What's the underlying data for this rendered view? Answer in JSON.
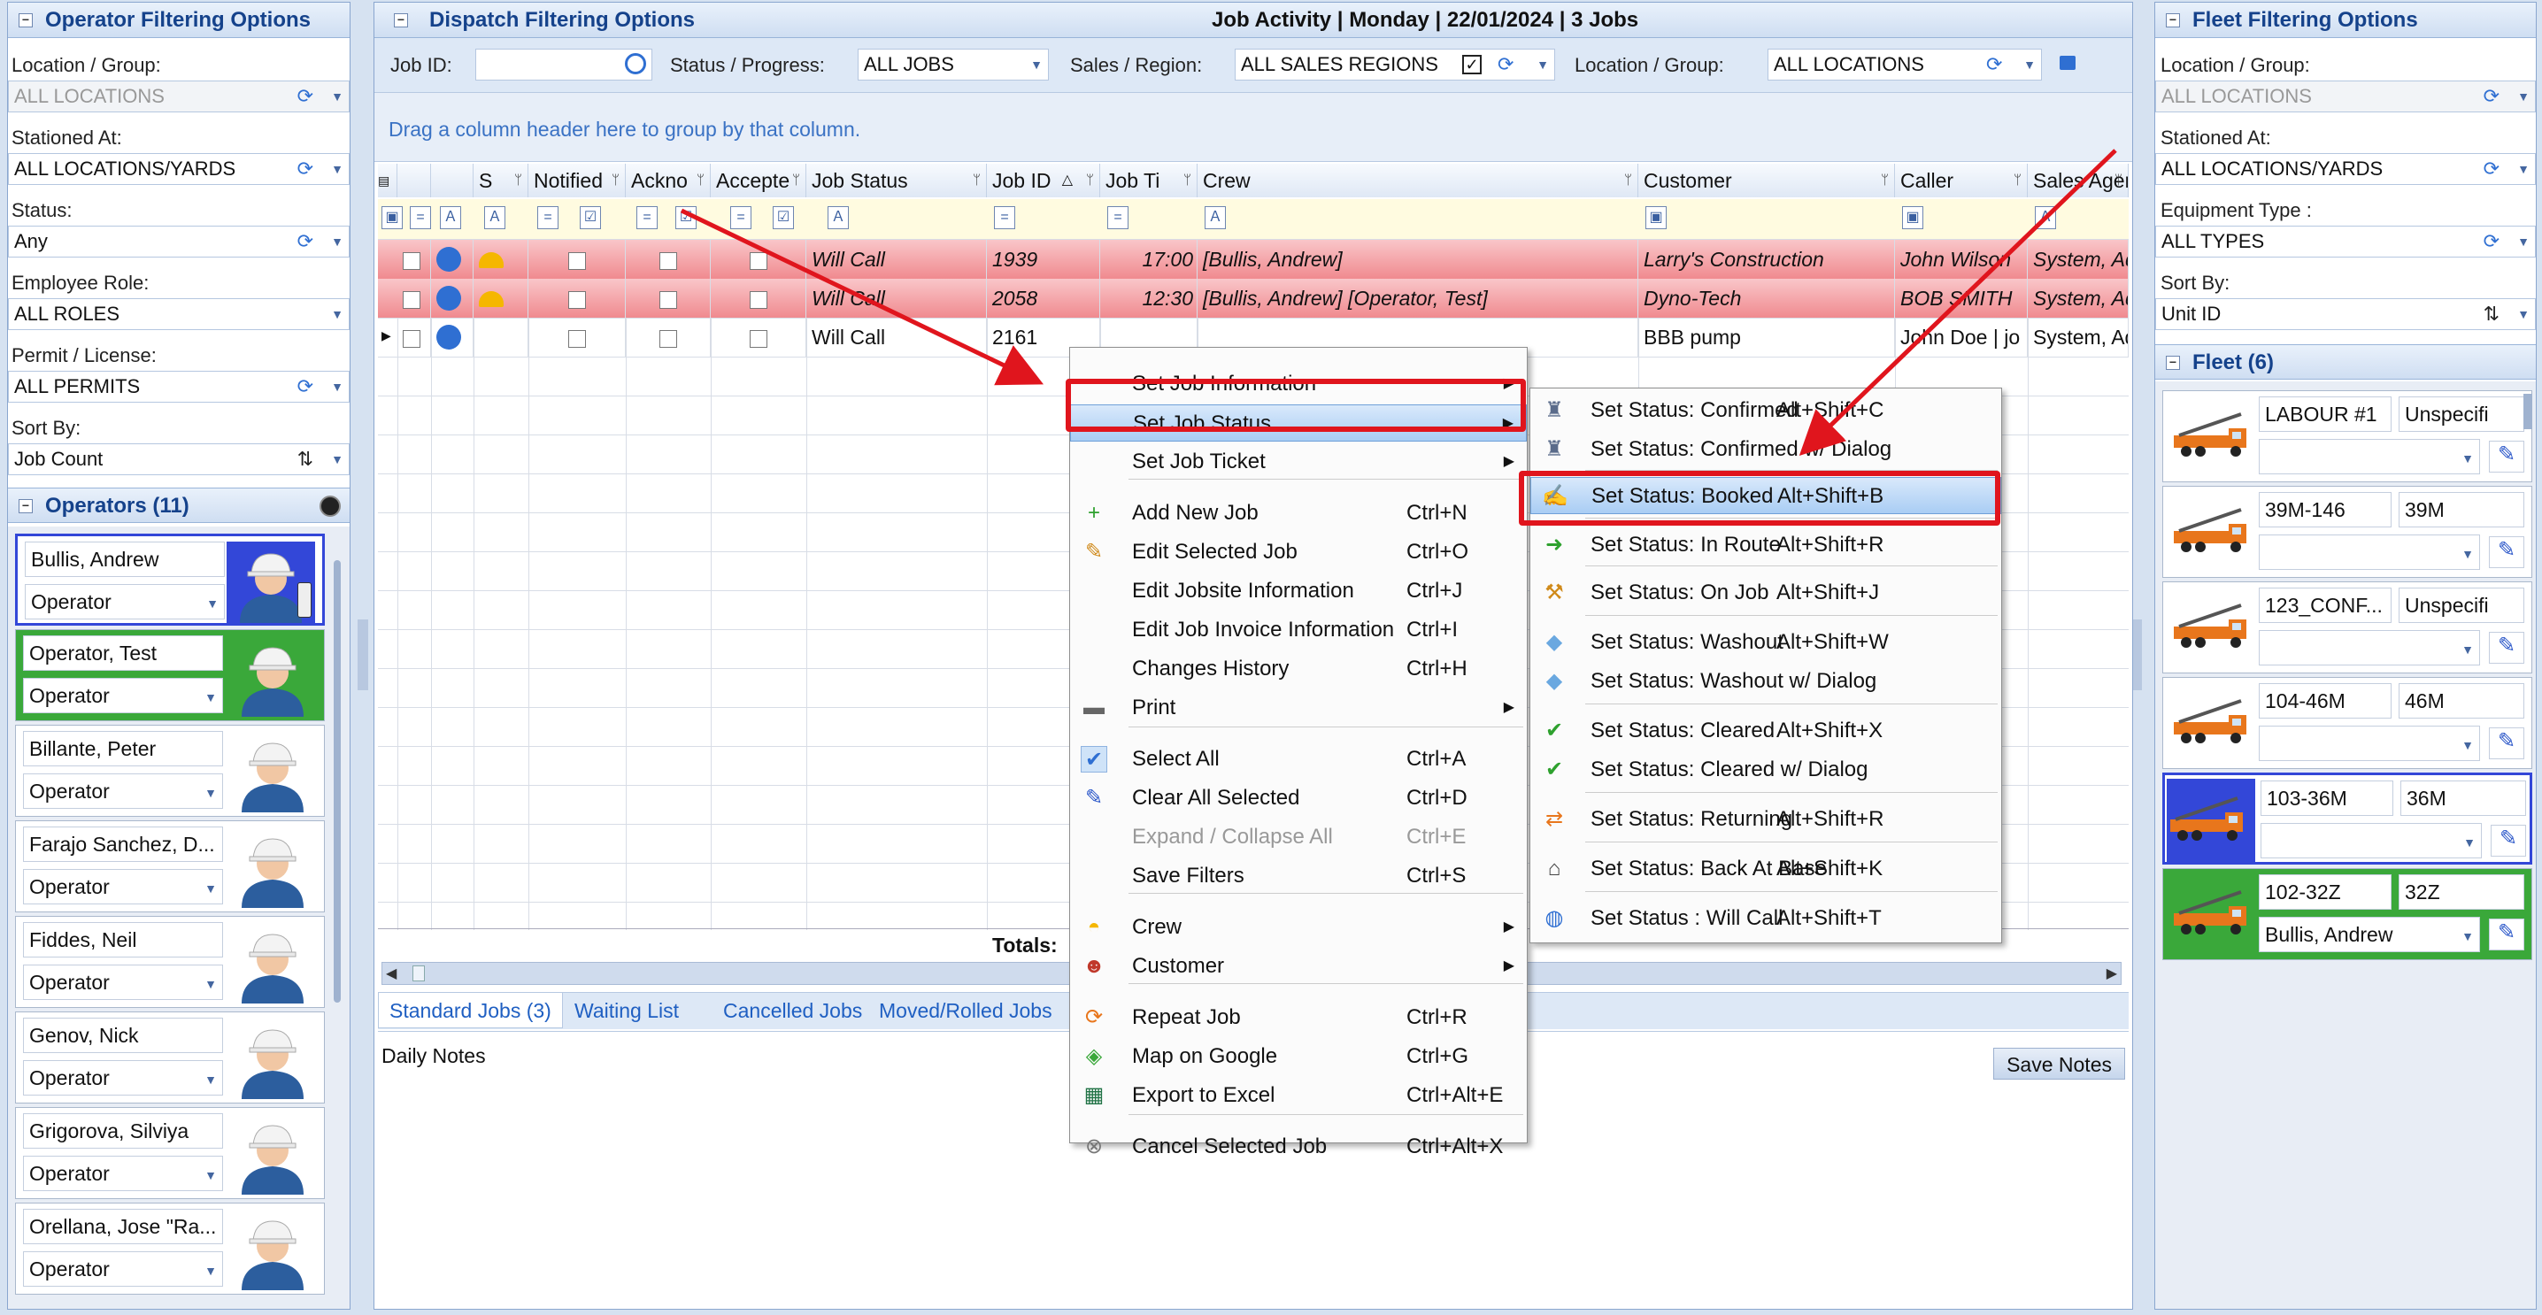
{
  "left_panel": {
    "title": "Operator Filtering Options",
    "fields": [
      {
        "label": "Location / Group:",
        "value": "ALL LOCATIONS",
        "disabled": true
      },
      {
        "label": "Stationed At:",
        "value": "ALL LOCATIONS/YARDS"
      },
      {
        "label": "Status:",
        "value": "Any"
      },
      {
        "label": "Employee Role:",
        "value": "ALL ROLES"
      },
      {
        "label": "Permit / License:",
        "value": "ALL PERMITS"
      },
      {
        "label": "Sort By:",
        "value": "Job Count"
      }
    ],
    "operators_title": "Operators (11)",
    "operators": [
      {
        "name": "Bullis, Andrew",
        "role": "Operator",
        "state": "selected"
      },
      {
        "name": "Operator, Test",
        "role": "Operator",
        "state": "green"
      },
      {
        "name": "Billante, Peter",
        "role": "Operator",
        "state": "normal"
      },
      {
        "name": "Farajo Sanchez, D...",
        "role": "Operator",
        "state": "normal"
      },
      {
        "name": "Fiddes, Neil",
        "role": "Operator",
        "state": "normal"
      },
      {
        "name": "Genov, Nick",
        "role": "Operator",
        "state": "normal"
      },
      {
        "name": "Grigorova, Silviya",
        "role": "Operator",
        "state": "normal"
      },
      {
        "name": "Orellana, Jose \"Ra...",
        "role": "Operator",
        "state": "normal"
      }
    ]
  },
  "center": {
    "title": "Dispatch Filtering Options",
    "job_activity": "Job Activity | Monday | 22/01/2024 | 3 Jobs",
    "filters": {
      "job_id_label": "Job ID:",
      "job_id_value": "",
      "status_label": "Status / Progress:",
      "status_value": "ALL JOBS",
      "sales_label": "Sales / Region:",
      "sales_value": "ALL SALES REGIONS",
      "location_label": "Location / Group:",
      "location_value": "ALL LOCATIONS"
    },
    "group_hint": "Drag a column header here to group by that column.",
    "columns": [
      "S",
      "Notified",
      "Ackno",
      "Accepte",
      "Job Status",
      "Job ID",
      "Job Ti",
      "Crew",
      "Customer",
      "Caller",
      "Sales Agent"
    ],
    "rows": [
      {
        "status": "Will Call",
        "job_id": "1939",
        "time": "17:00",
        "crew": "[Bullis, Andrew]",
        "customer": "Larry's Construction",
        "caller": "John Wilson",
        "agent": "System, Adr",
        "highlight": true
      },
      {
        "status": "Will Call",
        "job_id": "2058",
        "time": "12:30",
        "crew": "[Bullis, Andrew] [Operator, Test]",
        "customer": "Dyno-Tech",
        "caller": "BOB SMITH",
        "agent": "System, Adr",
        "highlight": true
      },
      {
        "status": "Will Call",
        "job_id": "2161",
        "time": "",
        "crew": "",
        "customer": "BBB pump",
        "caller": "John Doe | jo",
        "agent": "System, Adr",
        "highlight": false
      }
    ],
    "totals_label": "Totals:",
    "tabs": [
      "Standard Jobs (3)",
      "Waiting List",
      "Cancelled Jobs",
      "Moved/Rolled Jobs"
    ],
    "daily_notes": "Daily Notes",
    "save_notes": "Save Notes"
  },
  "context_menu": {
    "items": [
      {
        "label": "Set Job Information",
        "shortcut": "",
        "submenu": true
      },
      {
        "label": "Set Job Status",
        "shortcut": "",
        "submenu": true,
        "highlight": true
      },
      {
        "label": "Set Job Ticket",
        "shortcut": "",
        "submenu": true
      },
      {
        "label": "Add New Job",
        "shortcut": "Ctrl+N",
        "icon": "plus-icon"
      },
      {
        "label": "Edit Selected Job",
        "shortcut": "Ctrl+O",
        "icon": "pencil-icon"
      },
      {
        "label": "Edit Jobsite Information",
        "shortcut": "Ctrl+J"
      },
      {
        "label": "Edit Job Invoice Information",
        "shortcut": "Ctrl+I"
      },
      {
        "label": "Changes History",
        "shortcut": "Ctrl+H"
      },
      {
        "label": "Print",
        "shortcut": "",
        "submenu": true,
        "icon": "printer-icon"
      },
      {
        "label": "Select All",
        "shortcut": "Ctrl+A",
        "icon": "check-icon"
      },
      {
        "label": "Clear All Selected",
        "shortcut": "Ctrl+D",
        "icon": "eraser-icon"
      },
      {
        "label": "Expand / Collapse All",
        "shortcut": "Ctrl+E",
        "disabled": true
      },
      {
        "label": "Save Filters",
        "shortcut": "Ctrl+S"
      },
      {
        "label": "Crew",
        "shortcut": "",
        "submenu": true,
        "icon": "hardhat-icon"
      },
      {
        "label": "Customer",
        "shortcut": "",
        "submenu": true,
        "icon": "people-icon"
      },
      {
        "label": "Repeat Job",
        "shortcut": "Ctrl+R",
        "icon": "repeat-icon"
      },
      {
        "label": "Map on Google",
        "shortcut": "Ctrl+G",
        "icon": "map-icon"
      },
      {
        "label": "Export to Excel",
        "shortcut": "Ctrl+Alt+E",
        "icon": "excel-icon"
      },
      {
        "label": "Cancel Selected Job",
        "shortcut": "Ctrl+Alt+X",
        "icon": "cancel-icon"
      }
    ]
  },
  "status_submenu": {
    "items": [
      {
        "label": "Set Status: Confirmed",
        "shortcut": "Alt+Shift+C",
        "icon": "confirmed-icon"
      },
      {
        "label": "Set Status: Confirmed w/ Dialog",
        "shortcut": "",
        "icon": "confirmed-icon"
      },
      {
        "label": "Set Status: Booked",
        "shortcut": "Alt+Shift+B",
        "icon": "booked-icon",
        "highlight": true
      },
      {
        "label": "Set Status: In Route",
        "shortcut": "Alt+Shift+R",
        "icon": "arrow-right-icon"
      },
      {
        "label": "Set Status: On Job",
        "shortcut": "Alt+Shift+J",
        "icon": "onjob-icon"
      },
      {
        "label": "Set Status: Washout",
        "shortcut": "Alt+Shift+W",
        "icon": "drop-icon"
      },
      {
        "label": "Set Status: Washout w/ Dialog",
        "shortcut": "",
        "icon": "drop-icon"
      },
      {
        "label": "Set Status: Cleared",
        "shortcut": "Alt+Shift+X",
        "icon": "check-icon"
      },
      {
        "label": "Set Status: Cleared w/ Dialog",
        "shortcut": "",
        "icon": "check-icon"
      },
      {
        "label": "Set Status: Returning",
        "shortcut": "Alt+Shift+R",
        "icon": "returning-icon"
      },
      {
        "label": "Set Status: Back At Base",
        "shortcut": "Alt+Shift+K",
        "icon": "home-icon"
      },
      {
        "label": "Set Status : Will Call",
        "shortcut": "Alt+Shift+T",
        "icon": "globe-icon"
      }
    ]
  },
  "right_panel": {
    "title": "Fleet Filtering Options",
    "fields": [
      {
        "label": "Location / Group:",
        "value": "ALL LOCATIONS",
        "disabled": true
      },
      {
        "label": "Stationed At:",
        "value": "ALL LOCATIONS/YARDS"
      },
      {
        "label": "Equipment Type :",
        "value": "ALL TYPES"
      },
      {
        "label": "Sort By:",
        "value": "Unit ID"
      }
    ],
    "fleet_title": "Fleet (6)",
    "fleet": [
      {
        "unit": "LABOUR #1",
        "type": "Unspecifi",
        "operator": "",
        "state": "normal"
      },
      {
        "unit": "39M-146",
        "type": "39M",
        "operator": "",
        "state": "normal"
      },
      {
        "unit": "123_CONF...",
        "type": "Unspecifi",
        "operator": "",
        "state": "normal"
      },
      {
        "unit": "104-46M",
        "type": "46M",
        "operator": "",
        "state": "normal"
      },
      {
        "unit": "103-36M",
        "type": "36M",
        "operator": "",
        "state": "selected"
      },
      {
        "unit": "102-32Z",
        "type": "32Z",
        "operator": "Bullis, Andrew",
        "state": "green"
      }
    ]
  },
  "colors": {
    "accent_blue": "#15428b",
    "highlight_red": "#e0151d",
    "row_red": "#f08a8f",
    "selected_blue": "#3347d8",
    "green": "#3aa83a"
  }
}
